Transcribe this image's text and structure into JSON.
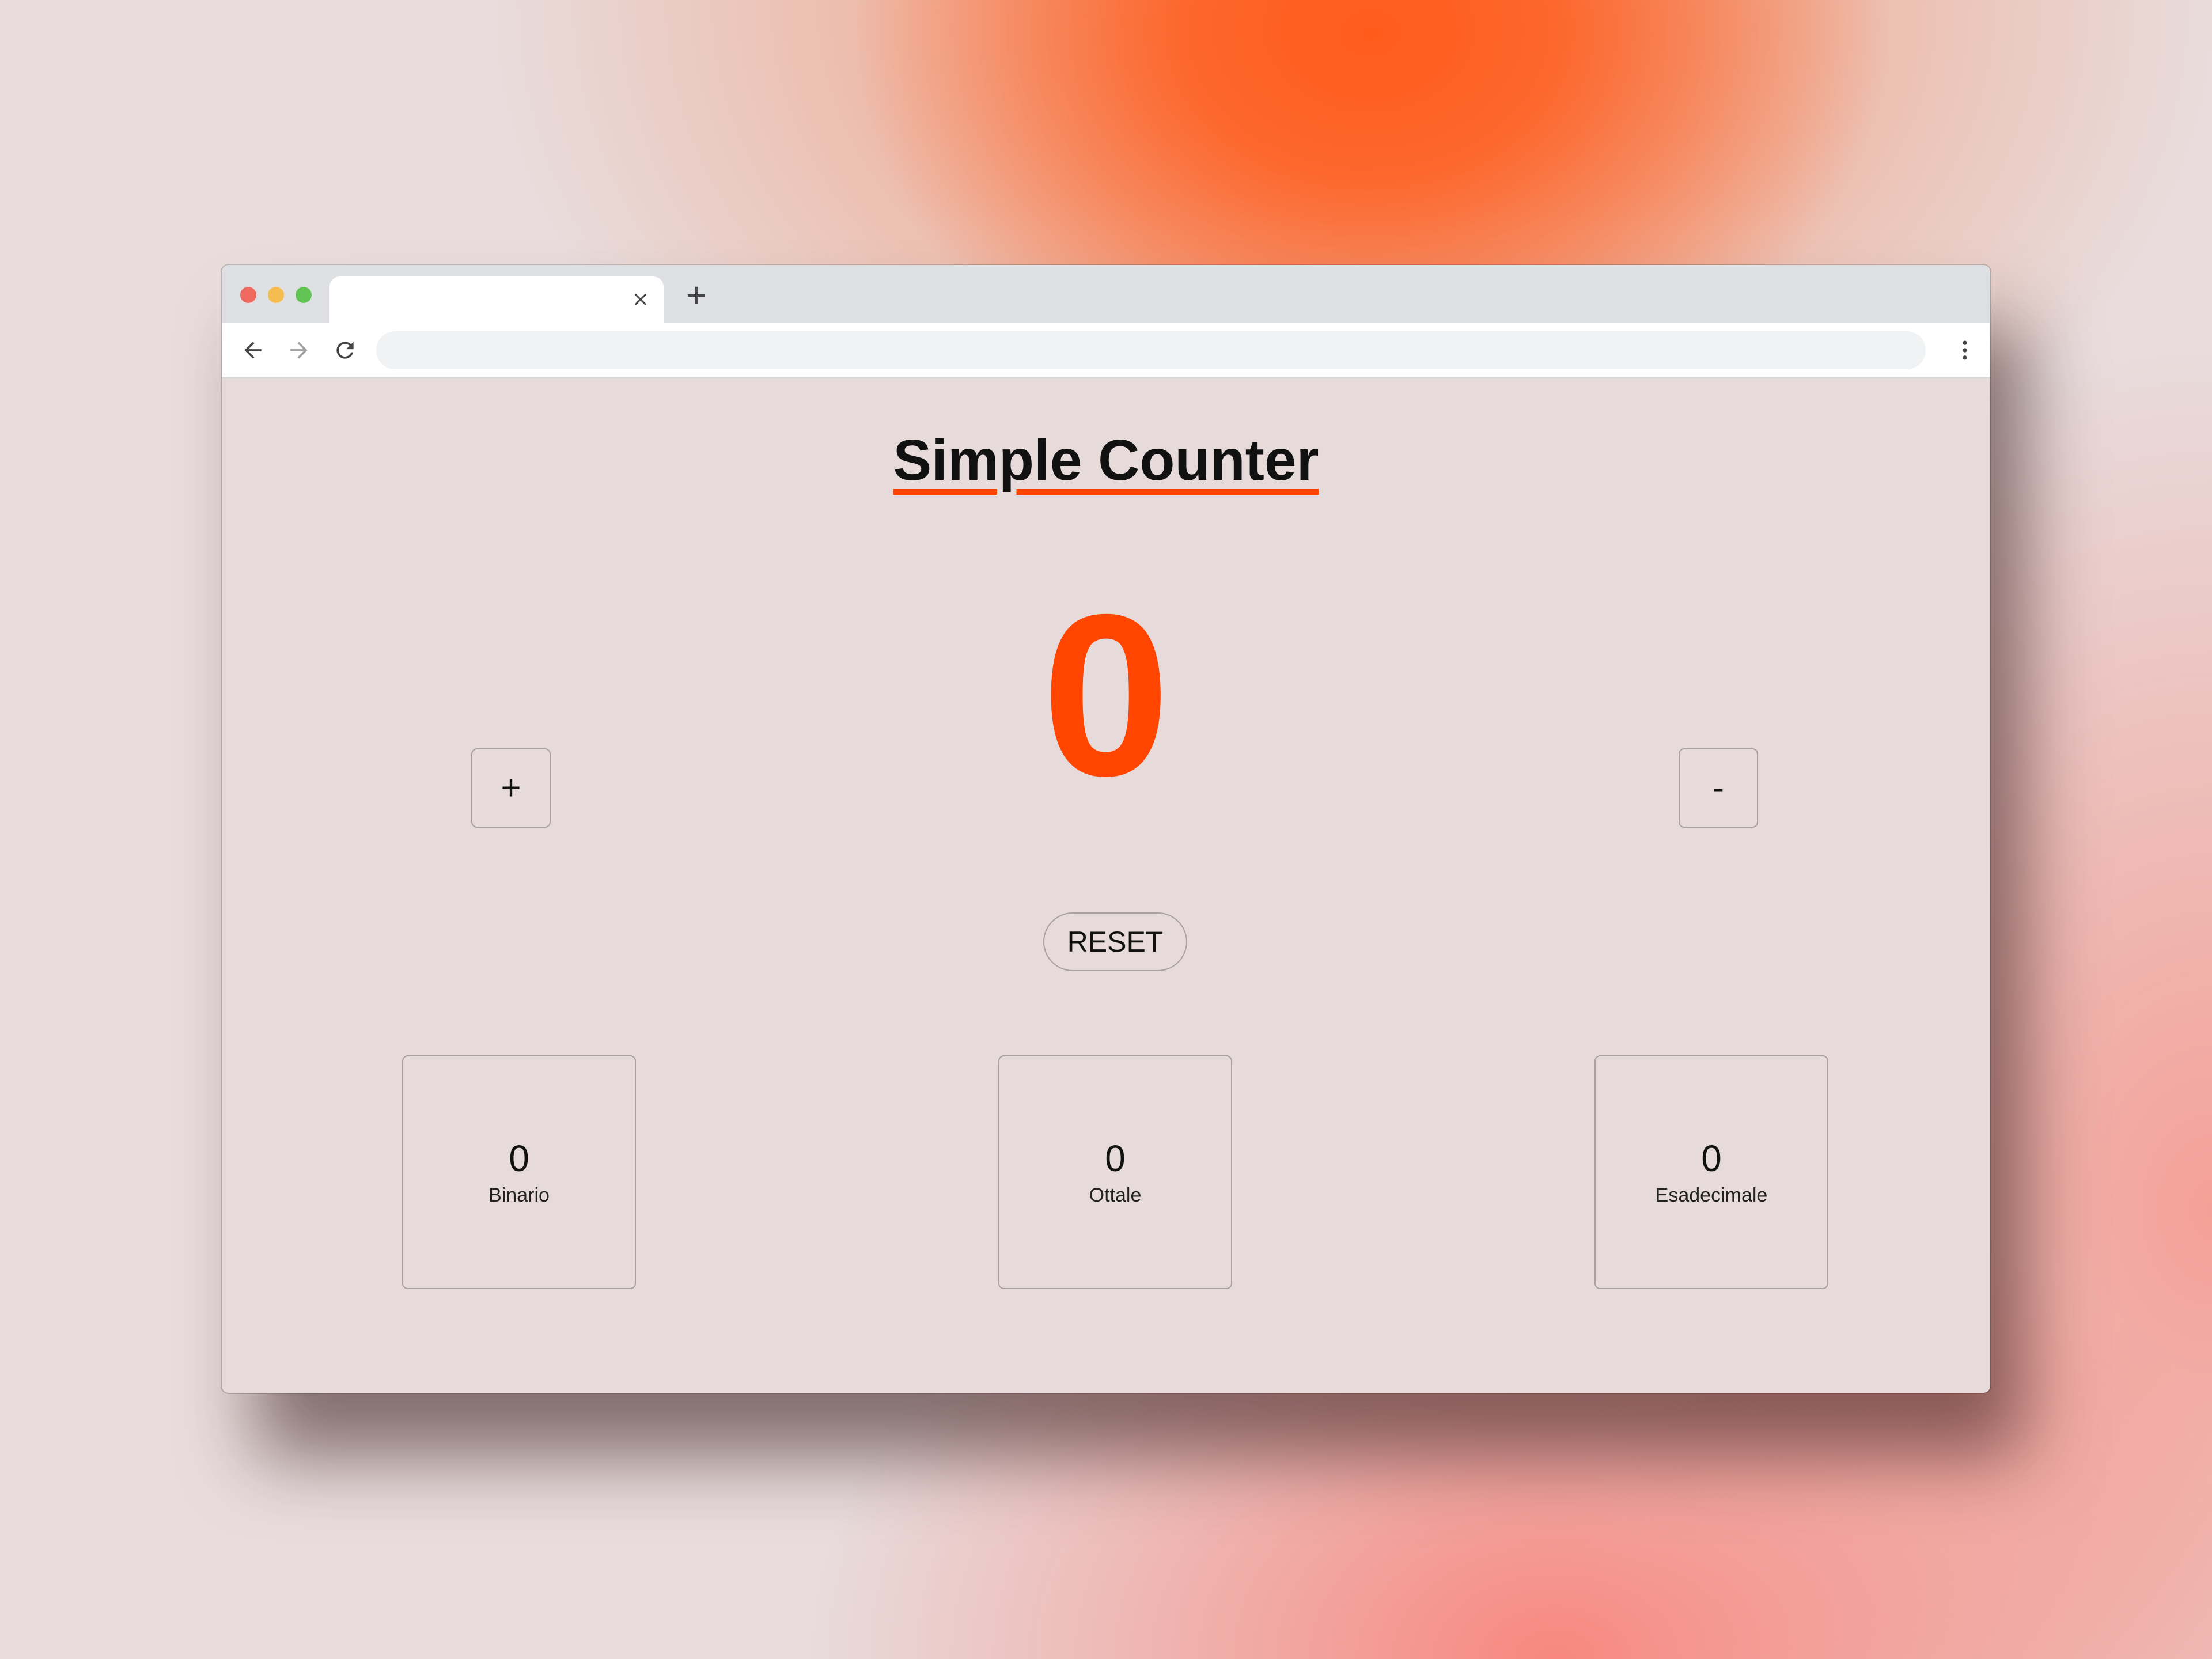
{
  "browser": {
    "tab_title": "",
    "tab_close_icon": "close-icon",
    "new_tab_icon": "plus-icon",
    "url": "",
    "colors": {
      "close": "#ee6a5f",
      "minimize": "#f5bd4f",
      "maximize": "#61c454"
    }
  },
  "page": {
    "title": "Simple Counter",
    "count": "0",
    "increment_label": "+",
    "decrement_label": "-",
    "reset_label": "RESET",
    "cards": {
      "binary": {
        "value": "0",
        "label": "Binario"
      },
      "octal": {
        "value": "0",
        "label": "Ottale"
      },
      "hex": {
        "value": "0",
        "label": "Esadecimale"
      }
    },
    "colors": {
      "accent": "#ff4500",
      "background": "#e7dada"
    }
  }
}
